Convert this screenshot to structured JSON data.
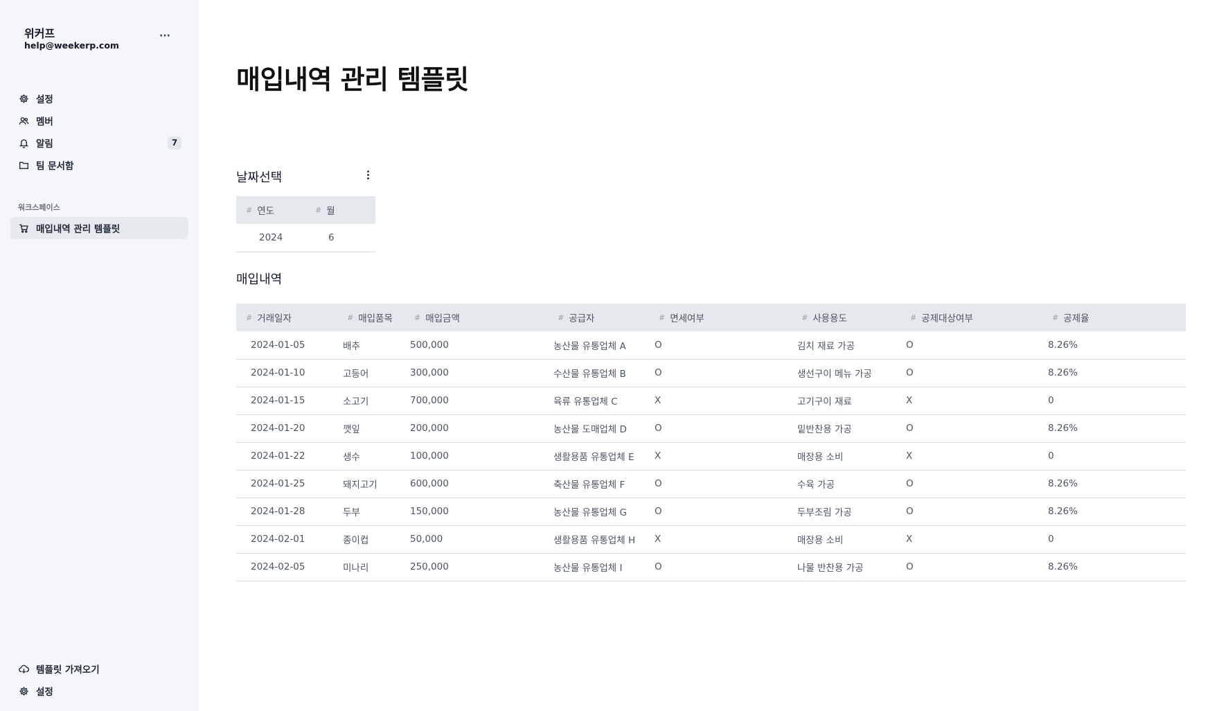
{
  "sidebar": {
    "workspace_name": "위커프",
    "email": "help@weekerp.com",
    "more_label": "···",
    "nav": [
      {
        "label": "설정",
        "icon": "gear-icon"
      },
      {
        "label": "멤버",
        "icon": "users-icon"
      },
      {
        "label": "알림",
        "icon": "bell-icon",
        "badge": "7"
      },
      {
        "label": "팀 문서함",
        "icon": "folder-icon"
      }
    ],
    "section_label": "워크스페이스",
    "workspace_items": [
      {
        "label": "매입내역 관리 템플릿",
        "icon": "cart-icon",
        "active": true
      }
    ],
    "footer": [
      {
        "label": "템플릿 가져오기",
        "icon": "cloud-download-icon"
      },
      {
        "label": "설정",
        "icon": "gear-icon"
      }
    ]
  },
  "main": {
    "title": "매입내역 관리 템플릿",
    "date_block": {
      "title": "날짜선택",
      "columns": [
        "연도",
        "월"
      ],
      "rows": [
        [
          "2024",
          "6"
        ]
      ]
    },
    "purchase_block": {
      "title": "매입내역",
      "columns": [
        "거래일자",
        "매입품목",
        "매입금액",
        "공급자",
        "면세여부",
        "사용용도",
        "공제대상여부",
        "공제율"
      ],
      "rows": [
        [
          "2024-01-05",
          "배추",
          "500,000",
          "농산물 유통업체 A",
          "O",
          "김치 재료 가공",
          "O",
          "8.26%"
        ],
        [
          "2024-01-10",
          "고등어",
          "300,000",
          "수산물 유통업체 B",
          "O",
          "생선구이 메뉴 가공",
          "O",
          "8.26%"
        ],
        [
          "2024-01-15",
          "소고기",
          "700,000",
          "육류 유통업체 C",
          "X",
          "고기구이 재료",
          "X",
          "0"
        ],
        [
          "2024-01-20",
          "깻잎",
          "200,000",
          "농산물 도매업체 D",
          "O",
          "밑반찬용 가공",
          "O",
          "8.26%"
        ],
        [
          "2024-01-22",
          "생수",
          "100,000",
          "생활용품 유통업체 E",
          "X",
          "매장용 소비",
          "X",
          "0"
        ],
        [
          "2024-01-25",
          "돼지고기",
          "600,000",
          "축산물 유통업체 F",
          "O",
          "수육 가공",
          "O",
          "8.26%"
        ],
        [
          "2024-01-28",
          "두부",
          "150,000",
          "농산물 유통업체 G",
          "O",
          "두부조림 가공",
          "O",
          "8.26%"
        ],
        [
          "2024-02-01",
          "종이컵",
          "50,000",
          "생활용품 유통업체 H",
          "X",
          "매장용 소비",
          "X",
          "0"
        ],
        [
          "2024-02-05",
          "미나리",
          "250,000",
          "농산물 유통업체 I",
          "O",
          "나물 반찬용 가공",
          "O",
          "8.26%"
        ]
      ]
    }
  }
}
